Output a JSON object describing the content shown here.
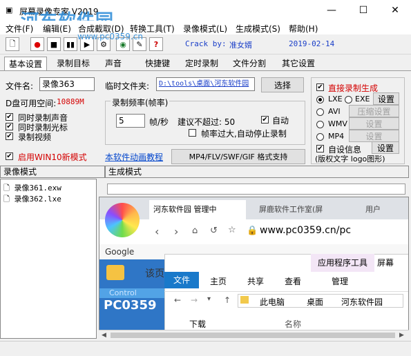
{
  "window": {
    "title": "屏幕录像专家 V2019",
    "watermark": "河东软件园",
    "watermark_url": "www.pc0359.cn",
    "minimize": "—",
    "maximize": "☐",
    "close": "✕"
  },
  "menu": [
    "文件(F)",
    "编辑(E)",
    "合成截取(D)",
    "转换工具(T)",
    "录像模式(L)",
    "生成模式(S)",
    "帮助(H)"
  ],
  "toolbar": {
    "crack_label": "Crack by:",
    "crack_by": "准女婿",
    "date": "2019-02-14"
  },
  "tabs": [
    "基本设置",
    "录制目标",
    "声音",
    "快捷键",
    "定时录制",
    "文件分割",
    "其它设置"
  ],
  "basic": {
    "filename_label": "文件名:",
    "filename_value": "录像363",
    "disk_space_label": "D盘可用空间:",
    "disk_space_value": "10889M",
    "temp_folder_label": "临时文件夹:",
    "temp_folder_value": "D:\\tools\\桌面\\河东软件园",
    "browse_button": "选择",
    "chk_sound": "同时录制声音",
    "chk_cursor": "同时录制光标",
    "chk_video": "录制视频",
    "chk_win10": "启用WIN10新模式",
    "rate_group_title": "录制频率(帧率)",
    "fps_value": "5",
    "fps_unit": "帧/秒",
    "suggest_label": "建议不超过: 50",
    "auto_label": "自动",
    "auto_stop_label": "帧率过大,自动停止录制",
    "tutorial_link": "本软件动画教程",
    "format_button": "MP4/FLV/SWF/GIF  格式支持"
  },
  "right_panel": {
    "direct_gen": "直接录制生成",
    "lxe": "LXE",
    "exe": "EXE",
    "settings": "设置",
    "avi": "AVI",
    "compress_settings": "压缩设置",
    "wmv": "WMV",
    "wmv_settings": "设置",
    "mp4": "MP4",
    "mp4_settings": "设置",
    "self_info": "自设信息",
    "self_info_settings": "设置",
    "note": "(版权文字 logo图形)"
  },
  "lower": {
    "left_tab": "录像模式",
    "right_tab": "生成模式",
    "files": [
      "录像361.exw",
      "录像362.lxe"
    ]
  },
  "preview": {
    "browser_tab1": "河东软件园 管理中",
    "browser_tab2": "屏鹿软件工作室(屏",
    "browser_tab3": "用户",
    "url": "www.pc0359.cn/pc",
    "google_label": "Google",
    "site_text": "PC0359",
    "control_text": "Control",
    "explorer_tab_app": "应用程序工具",
    "explorer_tab_screen": "屏幕",
    "explorer_file": "文件",
    "explorer_home": "主页",
    "explorer_share": "共享",
    "explorer_view": "查看",
    "explorer_manage": "管理",
    "explorer_path1": "此电脑",
    "explorer_path2": "桌面",
    "explorer_path3": "河东软件园",
    "explorer_download": "下载",
    "explorer_name": "名称",
    "page_char": "该页"
  },
  "colors": {
    "accent_blue": "#1a3ec8",
    "red_text": "#d40000",
    "ribbon_blue": "#1979ca"
  }
}
